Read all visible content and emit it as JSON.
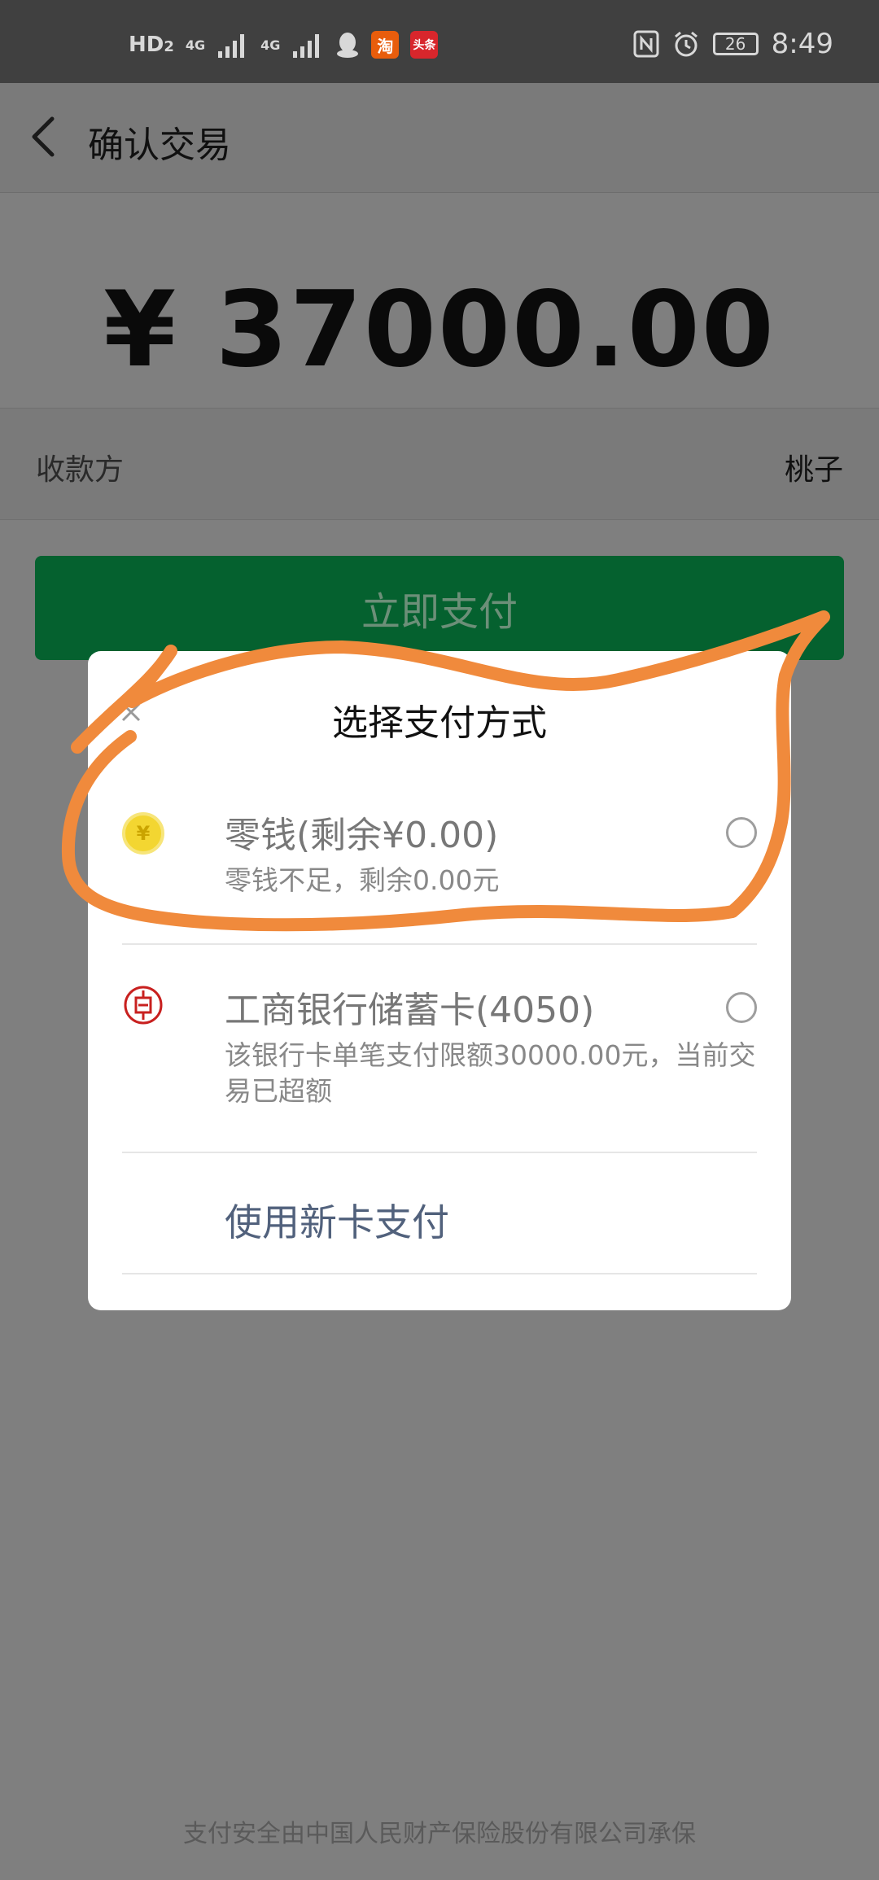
{
  "status_bar": {
    "hd_label": "HD",
    "sim_slot": "2",
    "net1": "4G",
    "net2": "4G",
    "taobao_badge": "淘",
    "toutiao_badge": "头条",
    "battery": "26",
    "time": "8:49",
    "icons": [
      "signal-icon",
      "qq-icon",
      "taobao-icon",
      "toutiao-icon",
      "nfc-icon",
      "alarm-icon",
      "battery-icon"
    ]
  },
  "header": {
    "title": "确认交易"
  },
  "amount": "¥ 37000.00",
  "payee": {
    "label": "收款方",
    "value": "桃子"
  },
  "pay_button": {
    "label": "立即支付"
  },
  "sheet": {
    "title": "选择支付方式",
    "options": [
      {
        "icon": "coin-icon",
        "coin_glyph": "¥",
        "name": "零钱(剩余¥0.00)",
        "desc": "零钱不足，剩余0.00元"
      },
      {
        "icon": "icbc-icon",
        "name": "工商银行储蓄卡(4050)",
        "desc": "该银行卡单笔支付限额30000.00元，当前交易已超额"
      }
    ],
    "new_card": "使用新卡支付"
  },
  "footer": "支付安全由中国人民财产保险股份有限公司承保",
  "colors": {
    "pay_button": "#05612f",
    "link": "#51617c",
    "annotation": "#f08a3c"
  }
}
